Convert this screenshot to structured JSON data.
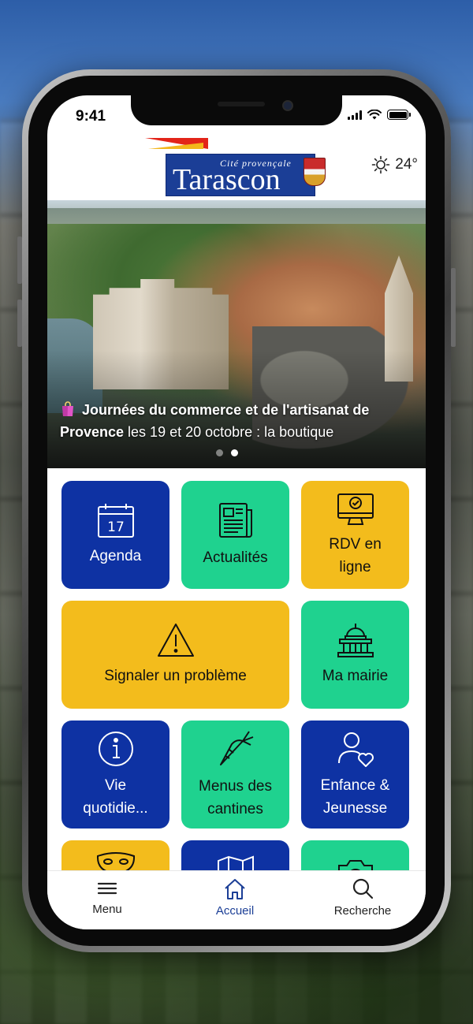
{
  "status_bar": {
    "time": "9:41"
  },
  "header": {
    "logo_subtitle": "Cité provençale",
    "logo_title": "Tarascon",
    "weather_temp": "24°",
    "weather_icon": "sun-icon"
  },
  "hero": {
    "caption_bold": "Journées du commerce et de l'artisanat de Provence",
    "caption_rest": " les 19 et 20 octobre : la boutique",
    "caption_icon": "shopping-bag-icon",
    "slide_count": 2,
    "active_slide": 2
  },
  "tiles": [
    {
      "label": "Agenda",
      "icon": "calendar-icon",
      "color": "#0e32a3"
    },
    {
      "label": "Actualités",
      "icon": "newspaper-icon",
      "color": "#1fd28f"
    },
    {
      "label": "RDV en ligne",
      "icon": "monitor-check-icon",
      "color": "#f3bc1c"
    },
    {
      "label": "Signaler un problème",
      "icon": "warning-icon",
      "color": "#f3bc1c"
    },
    {
      "label": "Ma mairie",
      "icon": "town-hall-icon",
      "color": "#1fd28f"
    },
    {
      "label": "Vie quotidie...",
      "icon": "info-icon",
      "color": "#0e32a3"
    },
    {
      "label": "Menus des cantines",
      "icon": "carrot-icon",
      "color": "#1fd28f"
    },
    {
      "label": "Enfance & Jeunesse",
      "icon": "person-heart-icon",
      "color": "#0e32a3"
    },
    {
      "label": "",
      "icon": "theater-mask-icon",
      "color": "#f3bc1c"
    },
    {
      "label": "",
      "icon": "map-icon",
      "color": "#0e32a3"
    },
    {
      "label": "",
      "icon": "camera-icon",
      "color": "#1fd28f"
    }
  ],
  "tabbar": {
    "items": [
      {
        "label": "Menu",
        "icon": "hamburger-menu-icon"
      },
      {
        "label": "Accueil",
        "icon": "home-icon"
      },
      {
        "label": "Recherche",
        "icon": "search-icon"
      }
    ],
    "active": "Accueil",
    "active_color": "#1b3e96"
  },
  "colors": {
    "blue": "#0e32a3",
    "green": "#1fd28f",
    "yellow": "#f3bc1c",
    "brand_red": "#e32419"
  }
}
